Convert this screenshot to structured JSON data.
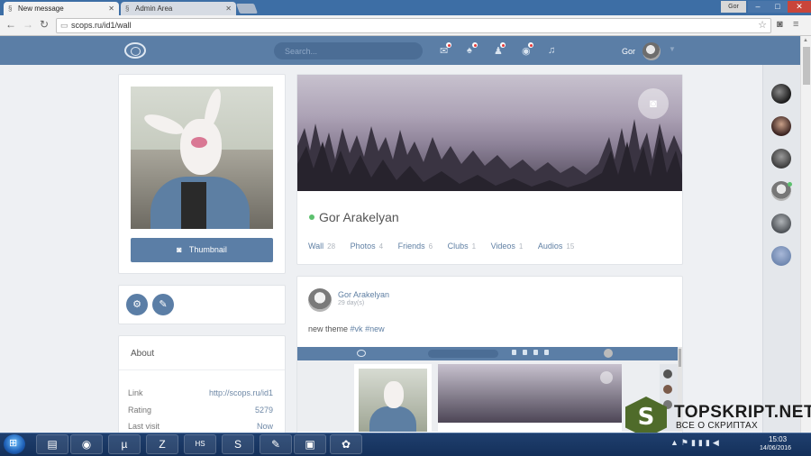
{
  "browser": {
    "tabs": [
      {
        "title": "New message",
        "active": true
      },
      {
        "title": "Admin Area",
        "active": false
      }
    ],
    "user_chip": "Gor",
    "url": "scops.ru/id1/wall"
  },
  "header": {
    "search_placeholder": "Search...",
    "username": "Gor",
    "icons": [
      "mail-icon",
      "bell-icon",
      "users-icon",
      "eye-icon",
      "music-icon"
    ]
  },
  "left": {
    "thumbnail_label": "Thumbnail",
    "about": {
      "title": "About",
      "rows": [
        {
          "label": "Link",
          "value": "http://scops.ru/id1"
        },
        {
          "label": "Rating",
          "value": "5279"
        },
        {
          "label": "Last visit",
          "value": "Now"
        }
      ]
    }
  },
  "profile": {
    "name": "Gor Arakelyan",
    "online": true,
    "tabs": [
      {
        "label": "Wall",
        "count": "28"
      },
      {
        "label": "Photos",
        "count": "4"
      },
      {
        "label": "Friends",
        "count": "6"
      },
      {
        "label": "Clubs",
        "count": "1"
      },
      {
        "label": "Videos",
        "count": "1"
      },
      {
        "label": "Audios",
        "count": "15"
      }
    ]
  },
  "post": {
    "author": "Gor Arakelyan",
    "time": "29 day(s)",
    "text": "new theme",
    "tags": [
      "#vk",
      "#new"
    ]
  },
  "watermark": {
    "letter": "S",
    "title": "TOPSKRIPT.NET",
    "subtitle": "ВСЕ О СКРИПТАХ"
  },
  "taskbar": {
    "time": "15:03",
    "date": "14/06/2016"
  },
  "colors": {
    "accent": "#5b7ea6",
    "online": "#5cc06e",
    "notify": "#e53b3b"
  }
}
